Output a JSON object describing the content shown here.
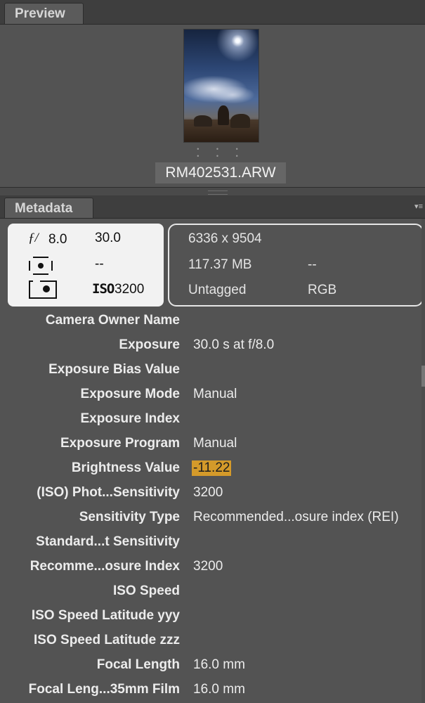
{
  "preview": {
    "tab_label": "Preview",
    "filename": "RM402531.ARW",
    "dots": "• • • • • •"
  },
  "metadata": {
    "tab_label": "Metadata",
    "menu_glyph": "▾≡",
    "placard": {
      "aperture_symbol": "ƒ/",
      "aperture_value": "8.0",
      "shutter": "30.0",
      "metering": "--",
      "iso_symbol": "ISO",
      "iso_value": "3200",
      "dimensions": "6336 x 9504",
      "file_size": "117.37 MB",
      "file_size_extra": "--",
      "color_profile": "Untagged",
      "color_mode": "RGB"
    },
    "rows": [
      {
        "label": "Camera Owner Name",
        "value": ""
      },
      {
        "label": "Exposure",
        "value": "30.0 s at f/8.0"
      },
      {
        "label": "Exposure Bias Value",
        "value": ""
      },
      {
        "label": "Exposure Mode",
        "value": "Manual"
      },
      {
        "label": "Exposure Index",
        "value": ""
      },
      {
        "label": "Exposure Program",
        "value": "Manual"
      },
      {
        "label": "Brightness Value",
        "value": "-11.22"
      },
      {
        "label": "(ISO) Phot...Sensitivity",
        "value": "3200"
      },
      {
        "label": "Sensitivity Type",
        "value": "Recommended...osure index (REI)"
      },
      {
        "label": "Standard...t Sensitivity",
        "value": ""
      },
      {
        "label": "Recomme...osure Index",
        "value": "3200"
      },
      {
        "label": "ISO Speed",
        "value": ""
      },
      {
        "label": "ISO Speed Latitude yyy",
        "value": ""
      },
      {
        "label": "ISO Speed Latitude zzz",
        "value": ""
      },
      {
        "label": "Focal Length",
        "value": "16.0 mm"
      },
      {
        "label": "Focal Leng...35mm Film",
        "value": "16.0 mm"
      }
    ]
  }
}
